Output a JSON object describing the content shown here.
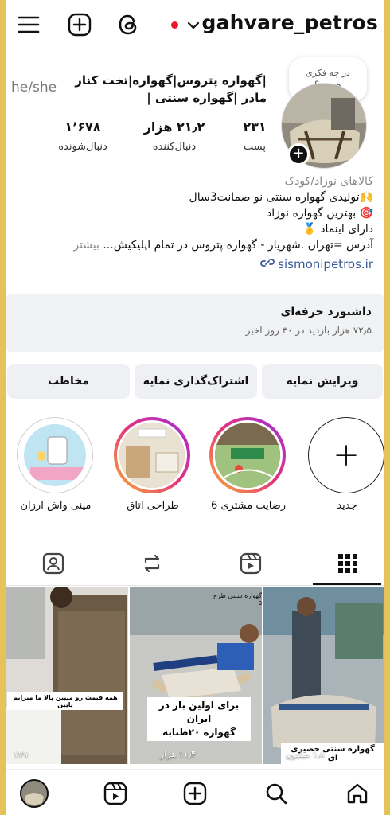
{
  "header": {
    "username": "gahvare_petros",
    "menu_icon": "hamburger-icon",
    "create_icon": "plus-square-icon",
    "threads_icon": "threads-icon"
  },
  "profile": {
    "note": "در چه فکری\nهستید؟",
    "full_name": "|گهواره پتروس|گهواره|تخت کنار مادر |گهواره سنتی |",
    "pronoun": "he/she",
    "stats": [
      {
        "num": "۲۳۱",
        "label": "پست"
      },
      {
        "num": "۲۱٫۲ هزار",
        "label": "دنبال‌کننده"
      },
      {
        "num": "۱٬۶۷۸",
        "label": "دنبال‌شونده"
      }
    ],
    "category": "کالاهای نوزاد/کودک",
    "bio_lines": [
      "🙌تولیدی گهواره سنتی نو ضمانت3سال",
      "🎯 بهترین گهواره نوزاد",
      "دارای اینماد 🥇"
    ],
    "address": "آدرس =تهران .شهریار - گهواره پتروس در تمام اپلیکیش...",
    "more": "بیشتر",
    "link": "sismonipetros.ir"
  },
  "dashboard": {
    "title": "داشبورد حرفه‌ای",
    "subtitle": "۷۲٫۵ هزار بازدید در ۳۰ روز اخیر."
  },
  "buttons": {
    "edit": "ویرایش نمایه",
    "share": "اشتراک‌گذاری نمایه",
    "contact": "مخاطب"
  },
  "highlights": [
    {
      "label": "جدید"
    },
    {
      "label": "رضایت مشتری 6"
    },
    {
      "label": "طراحی اتاق"
    },
    {
      "label": "مینی واش ارزان"
    }
  ],
  "posts": [
    {
      "caption": "برای اولین بار در ایران\nگهواره ۲۰طنابه",
      "views": "۱۱٫۴ هزار",
      "top_text": "گهواره سنتی طرح ۵"
    },
    {
      "caption": "گهواره سنتی حصیری ای",
      "views": "۱٫۸ میلیون"
    },
    {
      "caption": "همه قیمت رو میبین بالا ما میرایم پایین",
      "views": "۱۷۹"
    }
  ],
  "colors": {
    "accent_gradient": [
      "#f9b233",
      "#e5337a",
      "#9c2fe0"
    ],
    "link": "#385898",
    "frame": "#e6c35a"
  }
}
